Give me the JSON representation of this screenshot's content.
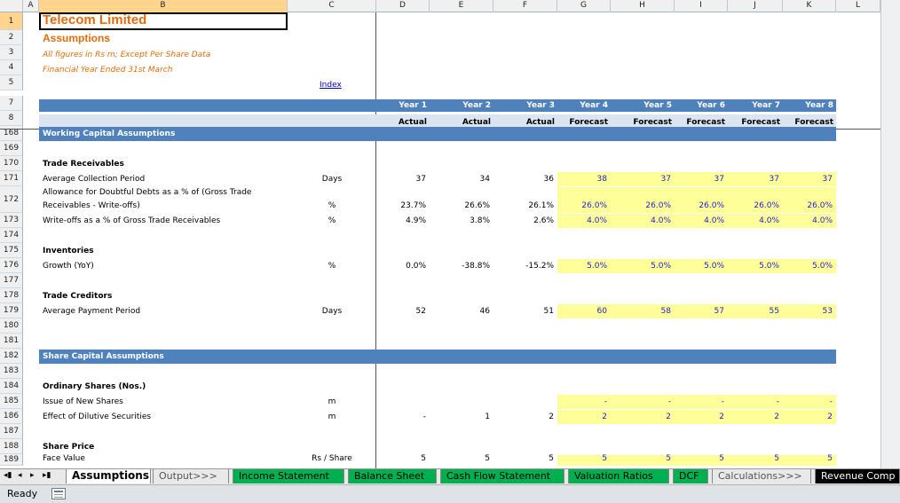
{
  "columns": [
    "A",
    "B",
    "C",
    "D",
    "E",
    "F",
    "G",
    "H",
    "I",
    "J",
    "K",
    "L"
  ],
  "header": {
    "title": "Telecom Limited",
    "subtitle": "Assumptions",
    "note1": "All figures in Rs m; Except Per Share Data",
    "note2": "Financial Year Ended 31st March",
    "index_link": "Index"
  },
  "years": [
    "Year 1",
    "Year 2",
    "Year 3",
    "Year 4",
    "Year 5",
    "Year 6",
    "Year 7",
    "Year 8"
  ],
  "year_types": [
    "Actual",
    "Actual",
    "Actual",
    "Forecast",
    "Forecast",
    "Forecast",
    "Forecast",
    "Forecast"
  ],
  "rows": [
    {
      "num": "1"
    },
    {
      "num": "2"
    },
    {
      "num": "3"
    },
    {
      "num": "4"
    },
    {
      "num": "5"
    },
    {
      "num": "7"
    },
    {
      "num": "8"
    },
    {
      "num": "168",
      "label": "Working Capital Assumptions",
      "type": "band"
    },
    {
      "num": "169"
    },
    {
      "num": "170",
      "label": "Trade Receivables",
      "type": "bold"
    },
    {
      "num": "171",
      "label": "Average Collection Period",
      "unit": "Days",
      "values": [
        "37",
        "34",
        "36",
        "38",
        "37",
        "37",
        "37",
        "37"
      ]
    },
    {
      "num": "172",
      "label": "Receivables - Write-offs)",
      "label_top": "Allowance for Doubtful Debts as a % of (Gross Trade",
      "unit": "%",
      "values": [
        "23.7%",
        "26.6%",
        "26.1%",
        "26.0%",
        "26.0%",
        "26.0%",
        "26.0%",
        "26.0%"
      ]
    },
    {
      "num": "173",
      "label": "Write-offs as a % of Gross Trade Receivables",
      "unit": "%",
      "values": [
        "4.9%",
        "3.8%",
        "2.6%",
        "4.0%",
        "4.0%",
        "4.0%",
        "4.0%",
        "4.0%"
      ]
    },
    {
      "num": "174"
    },
    {
      "num": "175",
      "label": "Inventories",
      "type": "bold"
    },
    {
      "num": "176",
      "label": "Growth (YoY)",
      "unit": "%",
      "values": [
        "0.0%",
        "-38.8%",
        "-15.2%",
        "5.0%",
        "5.0%",
        "5.0%",
        "5.0%",
        "5.0%"
      ]
    },
    {
      "num": "177"
    },
    {
      "num": "178",
      "label": "Trade Creditors",
      "type": "bold"
    },
    {
      "num": "179",
      "label": "Average Payment Period",
      "unit": "Days",
      "values": [
        "52",
        "46",
        "51",
        "60",
        "58",
        "57",
        "55",
        "53"
      ]
    },
    {
      "num": "180"
    },
    {
      "num": "181"
    },
    {
      "num": "182",
      "label": "Share Capital Assumptions",
      "type": "band"
    },
    {
      "num": "183"
    },
    {
      "num": "184",
      "label": "Ordinary Shares (Nos.)",
      "type": "bold"
    },
    {
      "num": "185",
      "label": "Issue of New Shares",
      "unit": "m",
      "values": [
        "",
        "",
        "",
        "-",
        "-",
        "-",
        "-",
        "-"
      ]
    },
    {
      "num": "186",
      "label": "Effect of Dilutive Securities",
      "unit": "m",
      "values": [
        "-",
        "1",
        "2",
        "2",
        "2",
        "2",
        "2",
        "2"
      ]
    },
    {
      "num": "187"
    },
    {
      "num": "188",
      "label": "Share Price",
      "type": "bold"
    },
    {
      "num": "189",
      "label": "Face Value",
      "unit": "Rs / Share",
      "values": [
        "5",
        "5",
        "5",
        "5",
        "5",
        "5",
        "5",
        "5"
      ]
    }
  ],
  "tabs": [
    "Assumptions",
    "Output>>>",
    "Income Statement",
    "Balance Sheet",
    "Cash Flow Statement",
    "Valuation Ratios",
    "DCF",
    "Calculations>>>",
    "Revenue Comp"
  ],
  "status": {
    "ready": "Ready"
  },
  "colors": {
    "accent": "#e46c0a",
    "band": "#4f81bd",
    "input_fill": "#ffff99",
    "tab_green": "#00b050"
  }
}
